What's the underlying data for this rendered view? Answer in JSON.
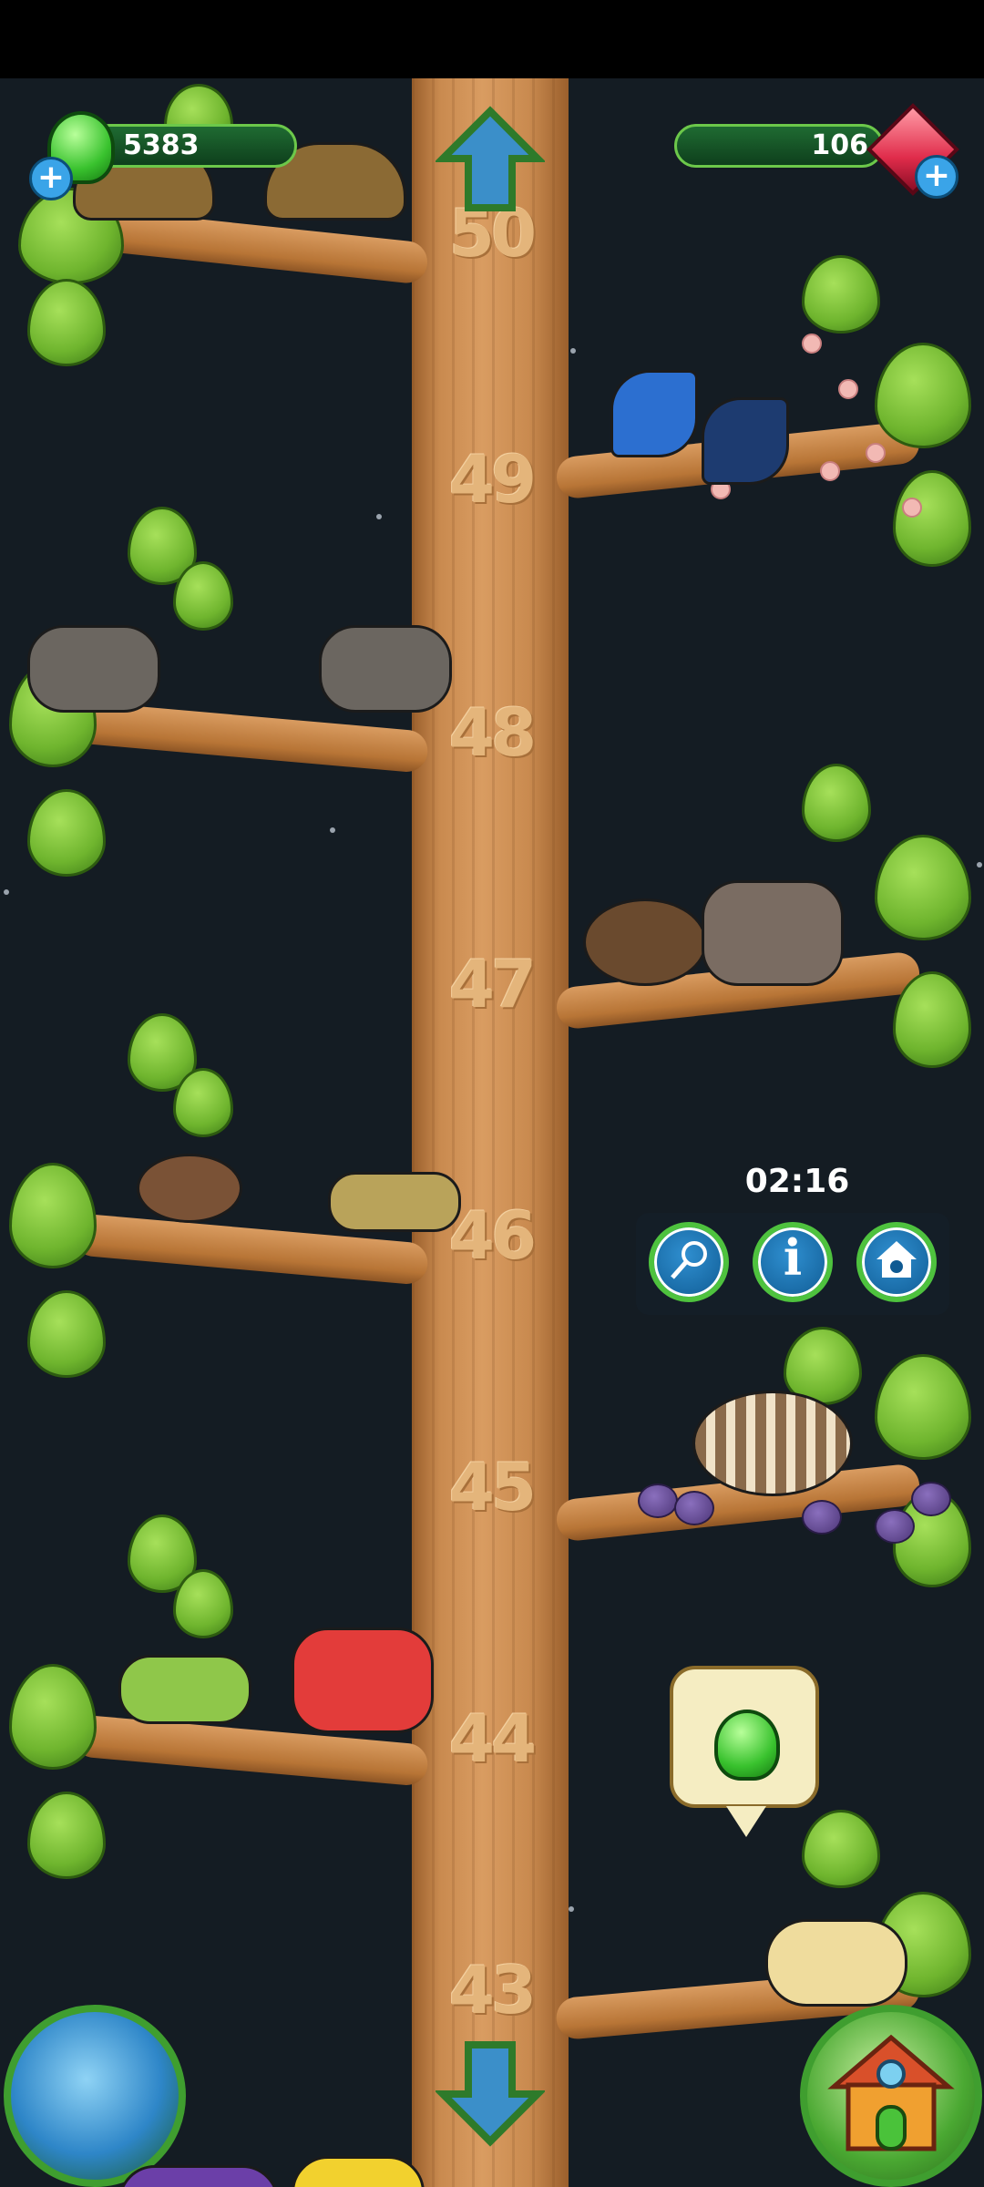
{
  "hud": {
    "jelly_count": "5383",
    "gem_count": "106",
    "jelly_icon": "green-jelly-icon",
    "gem_icon": "red-gem-icon",
    "add_icon": "plus-icon"
  },
  "tree": {
    "levels": [
      "50",
      "49",
      "48",
      "47",
      "46",
      "45",
      "44",
      "43"
    ]
  },
  "popup": {
    "timer": "02:16",
    "buttons": [
      "net-icon",
      "info-icon",
      "home-pet-icon"
    ]
  },
  "colors": {
    "trunk": "#c98a4f",
    "leaf": "#6fb52e",
    "hud_bar": "#1f6b32",
    "button_ring": "#4ec23e"
  }
}
